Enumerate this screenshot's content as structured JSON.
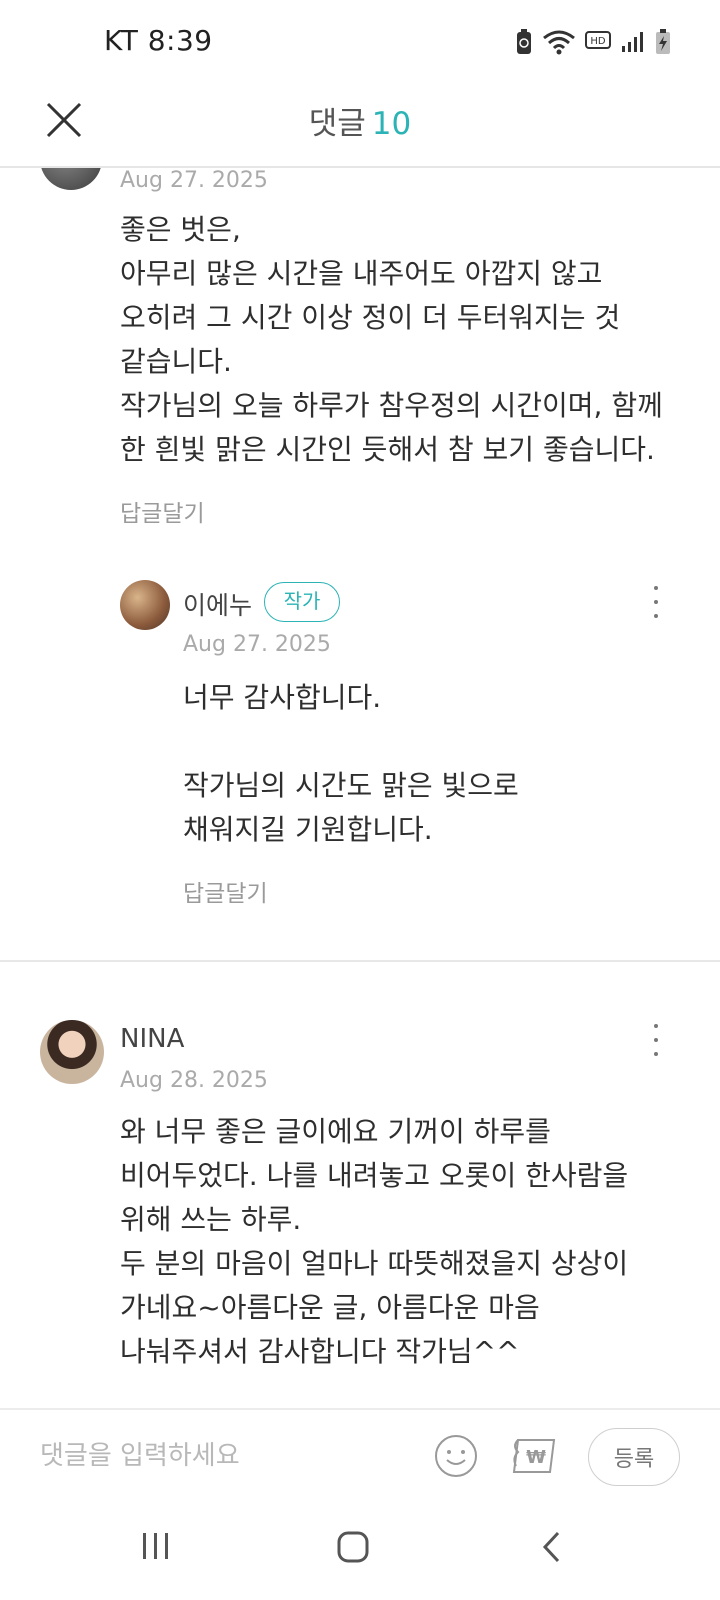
{
  "status_bar": {
    "carrier_time": "KT 8:39"
  },
  "header": {
    "title": "댓글",
    "count": "10"
  },
  "comments": [
    {
      "date": "Aug 27. 2025",
      "text": "좋은 벗은,\n아무리 많은 시간을 내주어도 아깝지 않고\n오히려 그 시간 이상 정이 더 두터워지는 것\n같습니다.\n작가님의 오늘 하루가 참우정의 시간이며, 함께\n한 흰빛 맑은 시간인 듯해서 참 보기 좋습니다.",
      "reply_label": "답글달기",
      "replies": [
        {
          "author": "이에누",
          "badge": "작가",
          "date": "Aug 27. 2025",
          "text": "너무 감사합니다.\n\n작가님의 시간도 맑은 빛으로\n채워지길 기원합니다.",
          "reply_label": "답글달기"
        }
      ]
    },
    {
      "author": "NINA",
      "date": "Aug 28. 2025",
      "text": "와 너무 좋은 글이에요 기꺼이 하루를\n비어두었다. 나를 내려놓고 오롯이 한사람을\n위해 쓰는 하루.\n두 분의 마음이 얼마나 따뜻해졌을지 상상이\n가네요~아름다운 글, 아름다운 마음\n나눠주셔서 감사합니다 작가님^^"
    }
  ],
  "input_bar": {
    "placeholder": "댓글을 입력하세요",
    "submit_label": "등록",
    "emoji_icon": "smiley-icon",
    "tip_icon": "won-ticket-icon"
  },
  "colors": {
    "accent": "#2bb3b5",
    "muted_text": "#aaaaaa"
  }
}
